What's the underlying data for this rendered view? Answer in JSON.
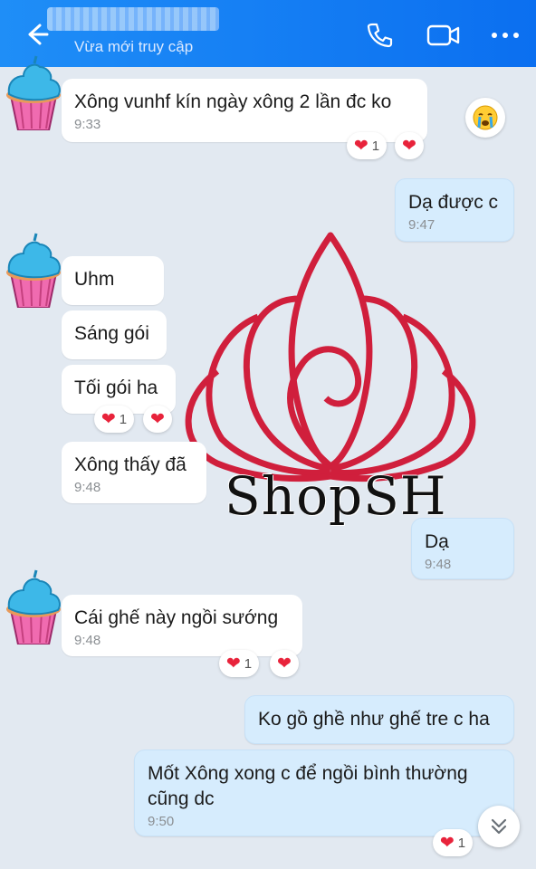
{
  "header": {
    "contact_name": "",
    "status": "Vừa mới truy cập",
    "back_icon": "arrow-left-icon",
    "call_icon": "phone-icon",
    "video_icon": "video-camera-icon",
    "more_icon": "more-dots-icon"
  },
  "messages": [
    {
      "text": "Xông vunhf kín ngày xông 2 lần đc ko",
      "time": "9:33",
      "reaction_count": "1"
    },
    {
      "text": "Dạ được c",
      "time": "9:47"
    },
    {
      "text": "Uhm"
    },
    {
      "text": "Sáng gói"
    },
    {
      "text": "Tối gói ha",
      "reaction_count": "1"
    },
    {
      "text": "Xông thấy đã",
      "time": "9:48"
    },
    {
      "text": "Dạ",
      "time": "9:48"
    },
    {
      "text": "Cái ghế này ngồi sướng",
      "time": "9:48",
      "reaction_count": "1"
    },
    {
      "text": "Ko gồ ghề như ghế tre c ha"
    },
    {
      "text": "Mốt  Xông xong c để ngồi bình thường cũng dc",
      "time": "9:50",
      "reaction_count": "1"
    }
  ],
  "watermark": {
    "text": "ShopSH"
  },
  "colors": {
    "header": "#0b6ff0",
    "outgoing": "#d6ecfd",
    "incoming": "#ffffff",
    "background": "#e2e9f1",
    "heart": "#e8233b"
  }
}
